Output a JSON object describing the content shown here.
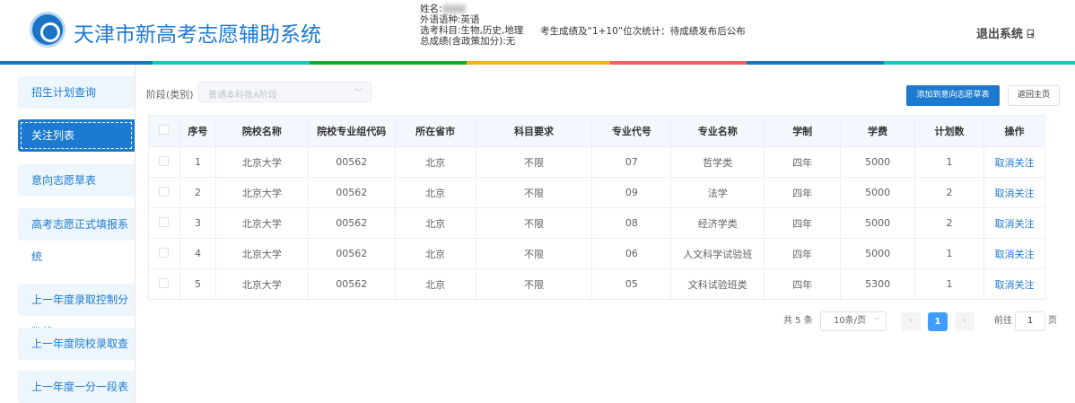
{
  "header": {
    "title": "天津市新高考志愿辅助系统",
    "name_label": "姓名:",
    "language": "外语语种:英语",
    "subjects": "选考科目:生物,历史,地理",
    "total_score": "总成绩(含政策加分):无",
    "score_stats": "考生成绩及“1+10”位次统计：待成绩发布后公布",
    "logout": "退出系统"
  },
  "colors": {
    "bar": [
      "#1677c9",
      "#13c9c0",
      "#16a82a",
      "#f7b21a",
      "#f0605e",
      "#1677c9",
      "#13c9c0"
    ],
    "accent": "#1c7ad0"
  },
  "sidebar": {
    "items": [
      {
        "label": "招生计划查询"
      },
      {
        "label": "关注列表",
        "active": true
      },
      {
        "label": "意向志愿草表"
      },
      {
        "label": "高考志愿正式填报系统"
      },
      {
        "label": "上一年度录取控制分数线"
      },
      {
        "label": "上一年度院校录取查询"
      },
      {
        "label": "上一年度一分一段表"
      }
    ]
  },
  "filter": {
    "label": "阶段(类别)",
    "placeholder": "普通本科批A阶段"
  },
  "actions": {
    "add": "添加到意向志愿草表",
    "back": "返回主页"
  },
  "table": {
    "headers": [
      "序号",
      "院校名称",
      "院校专业组代码",
      "所在省市",
      "科目要求",
      "专业代号",
      "专业名称",
      "学制",
      "学费",
      "计划数",
      "操作"
    ],
    "rows": [
      [
        "1",
        "北京大学",
        "00562",
        "北京",
        "不限",
        "07",
        "哲学类",
        "四年",
        "5000",
        "1",
        "取消关注"
      ],
      [
        "2",
        "北京大学",
        "00562",
        "北京",
        "不限",
        "09",
        "法学",
        "四年",
        "5000",
        "2",
        "取消关注"
      ],
      [
        "3",
        "北京大学",
        "00562",
        "北京",
        "不限",
        "08",
        "经济学类",
        "四年",
        "5000",
        "2",
        "取消关注"
      ],
      [
        "4",
        "北京大学",
        "00562",
        "北京",
        "不限",
        "06",
        "人文科学试验班",
        "四年",
        "5000",
        "1",
        "取消关注"
      ],
      [
        "5",
        "北京大学",
        "00562",
        "北京",
        "不限",
        "05",
        "文科试验班类",
        "四年",
        "5300",
        "1",
        "取消关注"
      ]
    ]
  },
  "pagination": {
    "total": "共 5 条",
    "page_size": "10条/页",
    "current": "1",
    "goto_label": "前往",
    "goto_value": "1",
    "page_suffix": "页"
  }
}
